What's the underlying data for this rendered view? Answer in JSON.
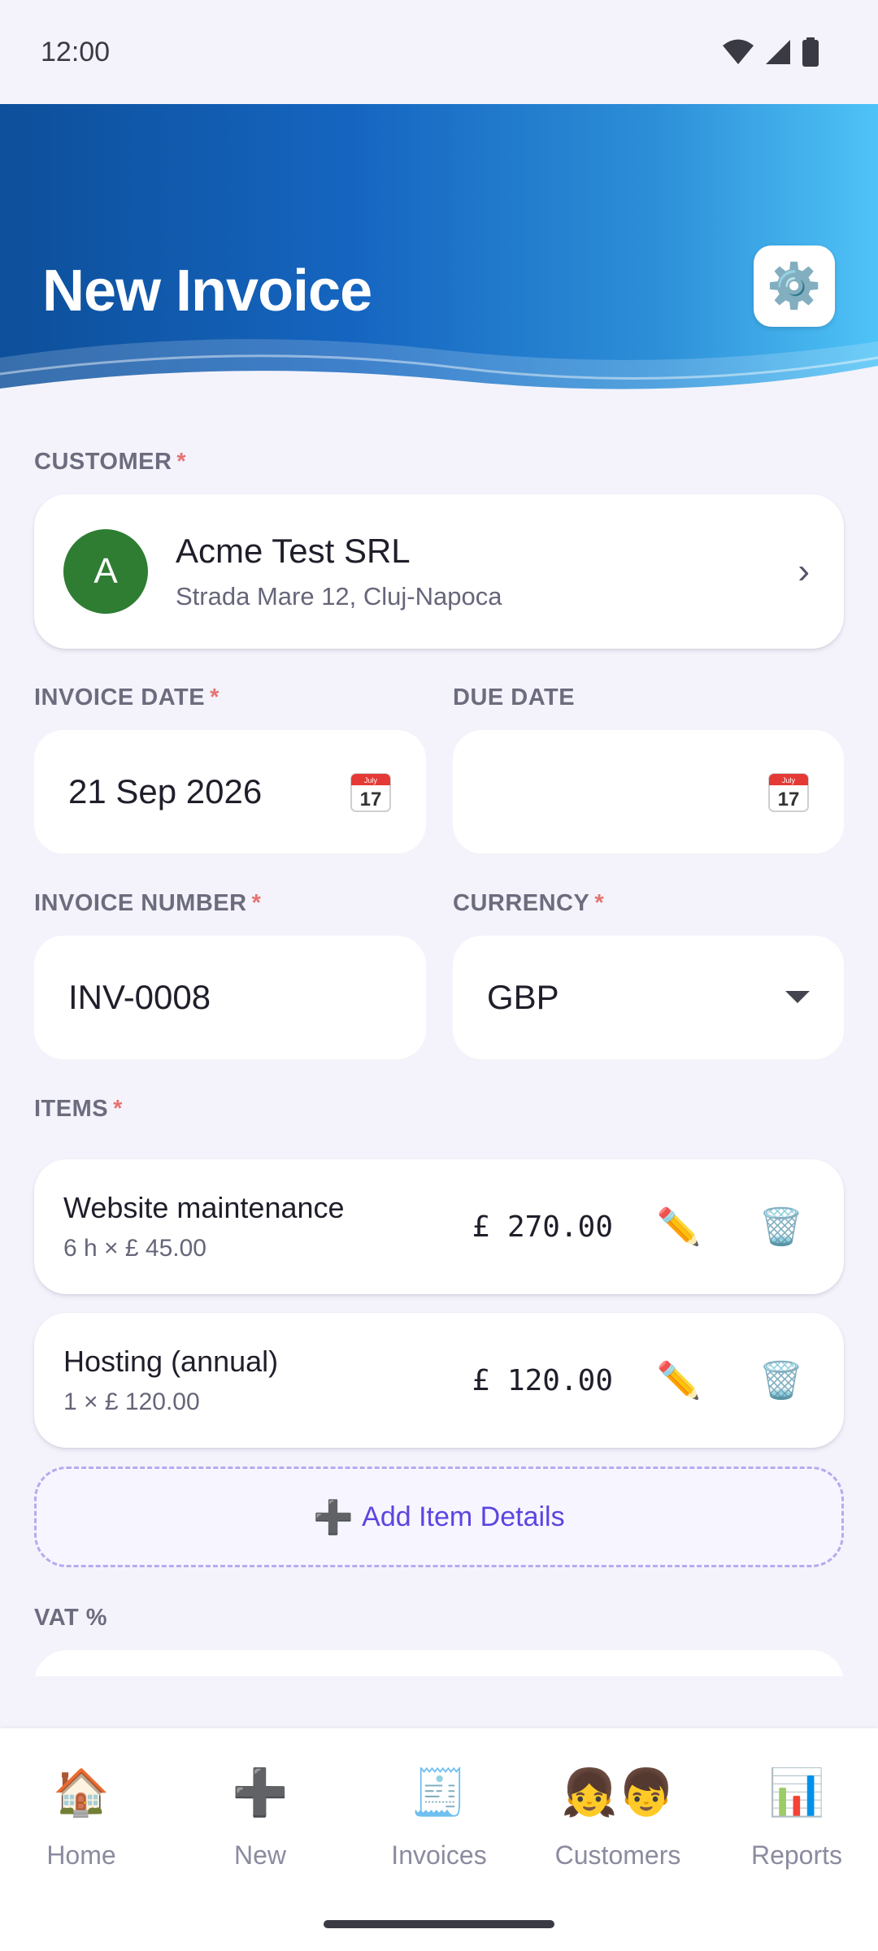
{
  "status_bar": {
    "time": "12:00"
  },
  "header": {
    "title": "New Invoice",
    "settings_icon": "⚙️"
  },
  "customer": {
    "label": "CUSTOMER",
    "required_mark": "*",
    "avatar_letter": "A",
    "name": "Acme Test SRL",
    "address": "Strada Mare 12, Cluj-Napoca",
    "chevron": "›",
    "avatar_color": "#2e7d32"
  },
  "invoice_date": {
    "label": "INVOICE DATE",
    "required_mark": "*",
    "value": "21 Sep 2026",
    "icon_month": "July",
    "icon_day": "17"
  },
  "due_date": {
    "label": "DUE DATE",
    "value": "",
    "icon_month": "July",
    "icon_day": "17"
  },
  "invoice_number": {
    "label": "INVOICE NUMBER",
    "required_mark": "*",
    "value": "INV-0008"
  },
  "currency": {
    "label": "CURRENCY",
    "required_mark": "*",
    "value": "GBP"
  },
  "items": {
    "label": "ITEMS",
    "required_mark": "*",
    "list": [
      {
        "name": "Website maintenance",
        "detail": "6 h × £ 45.00",
        "amount": "£ 270.00",
        "edit_icon": "✏️",
        "delete_icon": "🗑️"
      },
      {
        "name": "Hosting (annual)",
        "detail": "1 × £ 120.00",
        "amount": "£ 120.00",
        "edit_icon": "✏️",
        "delete_icon": "🗑️"
      }
    ],
    "add_icon": "➕",
    "add_label": "Add Item Details"
  },
  "vat": {
    "label": "VAT %"
  },
  "nav": [
    {
      "icon": "🏠",
      "label": "Home"
    },
    {
      "icon": "➕",
      "label": "New"
    },
    {
      "icon": "🧾",
      "label": "Invoices"
    },
    {
      "icon": "👧👦",
      "label": "Customers"
    },
    {
      "icon": "📊",
      "label": "Reports"
    }
  ],
  "colors": {
    "header_start": "#0d4f9a",
    "header_end": "#4fc3f7",
    "accent": "#5b45e0",
    "required": "#e57373"
  }
}
